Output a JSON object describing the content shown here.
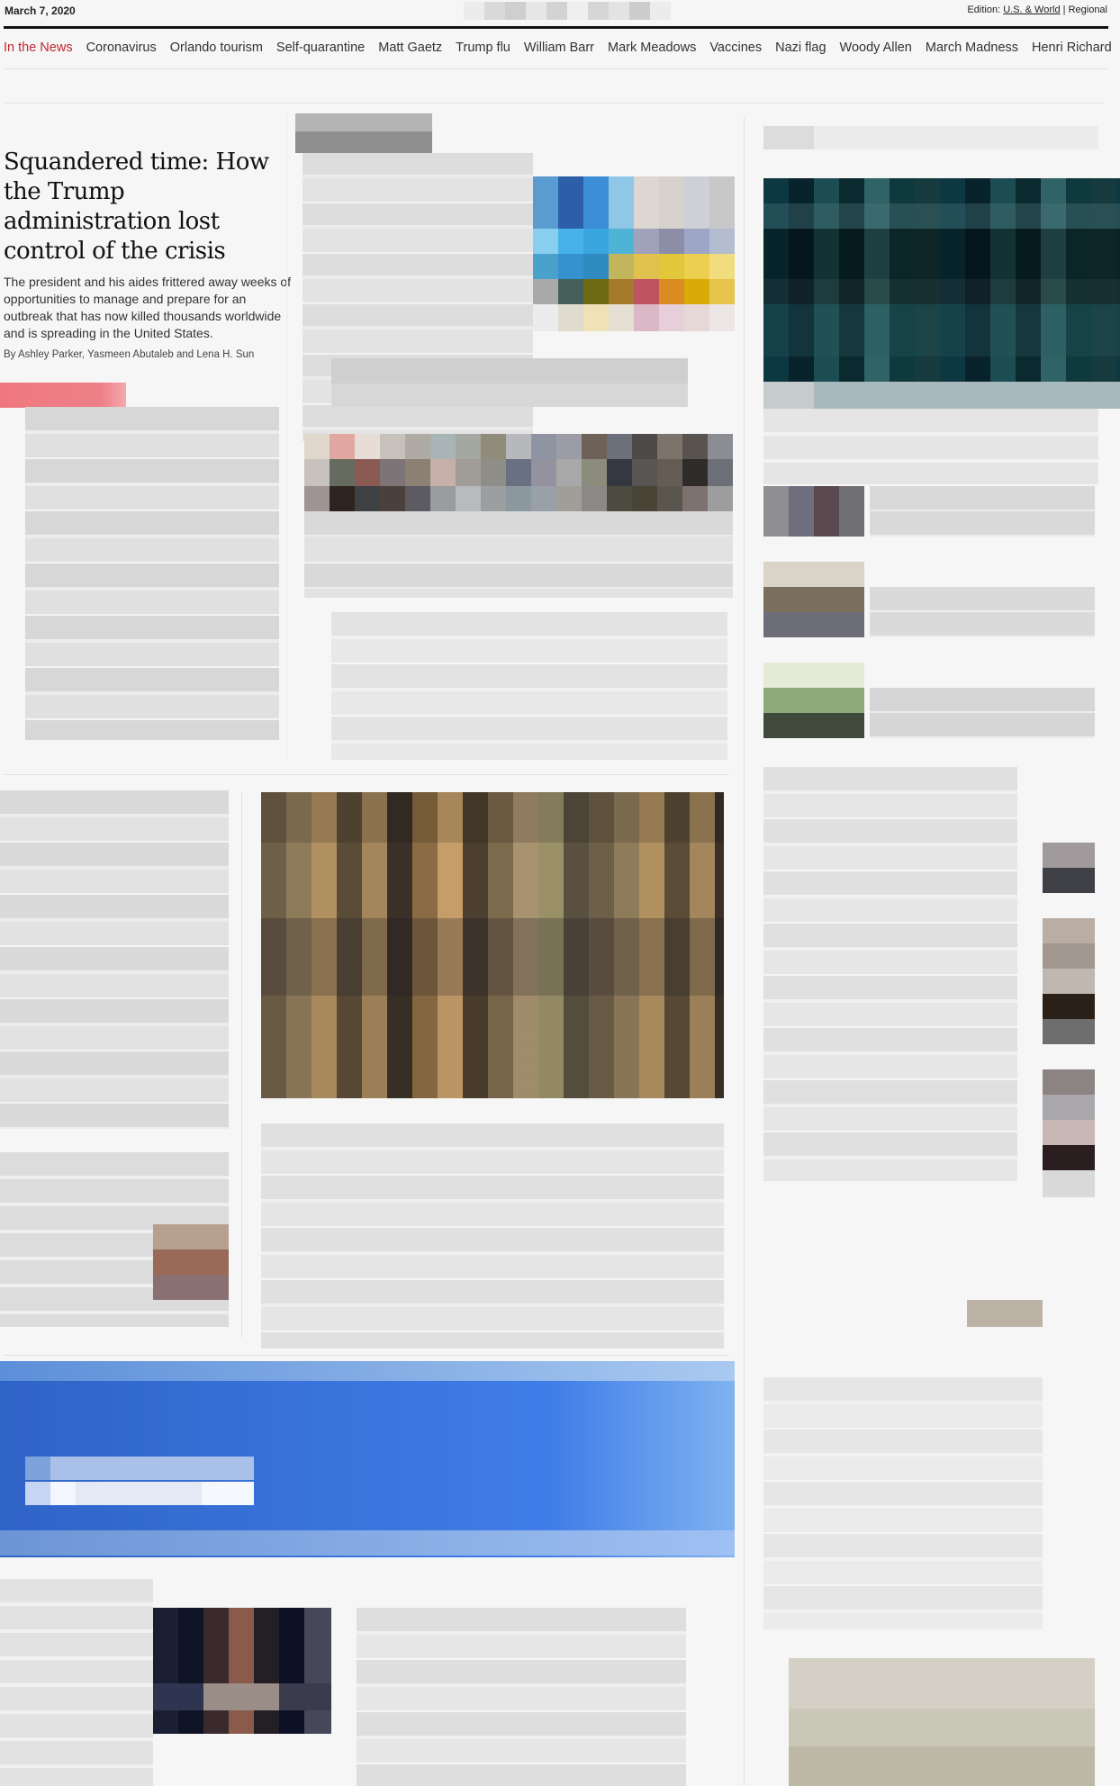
{
  "header": {
    "date": "March 7, 2020",
    "edition_label": "Edition:",
    "edition_us": "U.S. & World",
    "edition_sep": "|",
    "edition_regional": "Regional"
  },
  "nav": {
    "label": "In the News",
    "items": [
      "Coronavirus",
      "Orlando tourism",
      "Self-quarantine",
      "Matt Gaetz",
      "Trump flu",
      "William Barr",
      "Mark Meadows",
      "Vaccines",
      "Nazi flag",
      "Woody Allen",
      "March Madness",
      "Henri Richard"
    ]
  },
  "lead_story": {
    "headline": "Squandered time: How the Trump administration lost control of the crisis",
    "blurb": "The president and his aides frittered away weeks of opportunities to manage and prepare for an outbreak that has now killed thousands worldwide and is spreading in the United States.",
    "byline": "By Ashley Parker, Yasmeen Abutaleb and Lena H. Sun"
  },
  "colors": {
    "accent_red": "#c0282e",
    "highlight_bar": "#ef7c84",
    "promo_blue": "#3b6fd8"
  }
}
